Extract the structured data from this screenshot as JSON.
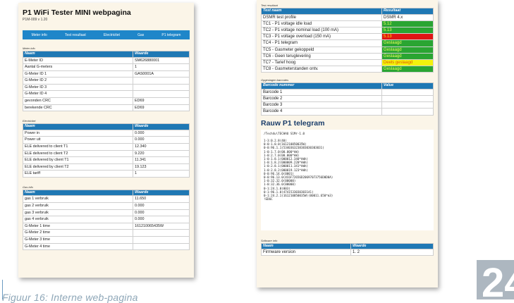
{
  "left": {
    "title": "P1 WiFi Tester MINI webpagina",
    "subtitle": "P1M-009 v 1.20",
    "nav": [
      "Meter info",
      "Test resultaat",
      "Electricitet",
      "Gas",
      "P1 telegram"
    ],
    "meter_info": {
      "label": "Meter info",
      "headers": [
        "Naam",
        "Waarde"
      ],
      "rows": [
        [
          "E-Meter ID",
          "SM626880001"
        ],
        [
          "Aantal G-meters",
          "1"
        ],
        [
          "G-Meter ID 1",
          "GAS0001A"
        ],
        [
          "G-Meter ID 2",
          ""
        ],
        [
          "G-Meter ID 3",
          ""
        ],
        [
          "G-Meter ID 4",
          ""
        ],
        [
          "gevonden CRC",
          "ED69"
        ],
        [
          "berekende CRC",
          "ED69"
        ]
      ]
    },
    "electricity": {
      "label": "Electricitet",
      "headers": [
        "Naam",
        "Waarde"
      ],
      "rows": [
        [
          "Power in",
          "0.000"
        ],
        [
          "Power uit",
          "0.000"
        ],
        [
          "ELE delivered to client T1",
          "12.340"
        ],
        [
          "ELE delivered to client T2",
          "9.220"
        ],
        [
          "ELE delivered by client T1",
          "11.341"
        ],
        [
          "ELE delivered by client T2",
          "19.123"
        ],
        [
          "ELE tariff",
          "1"
        ]
      ]
    },
    "gas": {
      "label": "Gas info",
      "headers": [
        "Naam",
        "Waarde"
      ],
      "rows": [
        [
          "gas 1 verbruik",
          "11.650"
        ],
        [
          "gas 2 verbruik",
          "0.000"
        ],
        [
          "gas 3 verbruik",
          "0.000"
        ],
        [
          "gas 4 verbruik",
          "0.000"
        ],
        [
          "G-Meter 1 time",
          "161210065435W"
        ],
        [
          "G-Meter 2 time",
          ""
        ],
        [
          "G-Meter 3 time",
          ""
        ],
        [
          "G-Meter 4 time",
          ""
        ]
      ]
    }
  },
  "right": {
    "test": {
      "label": "Test resultaat",
      "headers": [
        "Test naam",
        "Resultaat"
      ],
      "rows": [
        {
          "name": "DSMR test profile",
          "result": "DSMR 4.x",
          "status": "plain"
        },
        {
          "name": "TC1 - P1 voltage idle load",
          "result": "5.12",
          "status": "green"
        },
        {
          "name": "TC2 - P1 voltage nominal load (100 mA)",
          "result": "5.13",
          "status": "green"
        },
        {
          "name": "TC3 - P1 voltage overload (150 mA)",
          "result": "5.13",
          "status": "red"
        },
        {
          "name": "TC4 - P1 telegram",
          "result": "Geslaagd",
          "status": "green"
        },
        {
          "name": "TC5 - Gasmeter gekoppeld",
          "result": "Geslaagd",
          "status": "green"
        },
        {
          "name": "TC6 - Geen teruglevering",
          "result": "Geslaagd",
          "status": "green"
        },
        {
          "name": "TC7 - Tarief hoog",
          "result": "Deels geslaagd",
          "status": "yellow"
        },
        {
          "name": "TC8 - Gasmeterstanden ontv.",
          "result": "Geslaagd",
          "status": "green"
        }
      ]
    },
    "barcodes": {
      "label": "Opgeslagen barcodes",
      "headers": [
        "Barcode nummer",
        "Value"
      ],
      "rows": [
        [
          "Barcode 1",
          ""
        ],
        [
          "Barcode 2",
          ""
        ],
        [
          "Barcode 3",
          ""
        ],
        [
          "Barcode 4",
          ""
        ]
      ]
    },
    "raw": {
      "heading": "Rauw P1 telegram",
      "text": "/Tech4u\\TECHAU S1Mr-1.0\n\n1-3:0.2.8(40)\n0-0:1.0.0(161210050035W)\n0-0:96.1.1(5340363238383030303031)\n1-0:1.7.0(00.000*kW)\n1-0:2.7.0(00.000*kW)\n1-0:1.8.1(000012.340*kWh)\n1-0:1.8.2(000009.220*kWh)\n1-0:2.8.1(000011.341*kWh)\n1-0:2.8.2(000019.123*kWh)\n0-0:96.14.0(0001)\n0-0:96.13.0(4C6F72656D20697073756D0D0A)\n1-0:32.32.0(00000)\n1-0:32.36.0(00000)\n0-1:24.1.0(003)\n0-1:96.1.0(4741533030303141)\n0-1:24.2.1(161210050035W)(00011.650*m3)\n!ED6C"
    },
    "software": {
      "label": "Software info",
      "headers": [
        "Naam",
        "Waarde"
      ],
      "rows": [
        [
          "Firmware version",
          "1. 2"
        ]
      ]
    }
  },
  "caption": "Figuur 16: Interne web-pagina",
  "badge_number": "24",
  "colors": {
    "header_blue": "#1f78b4",
    "nav_blue": "#1f86c9",
    "pass_green": "#2aa532",
    "fail_red": "#e01515",
    "partial_yellow": "#f2f20d",
    "panel_bg": "#fbf5e8"
  }
}
